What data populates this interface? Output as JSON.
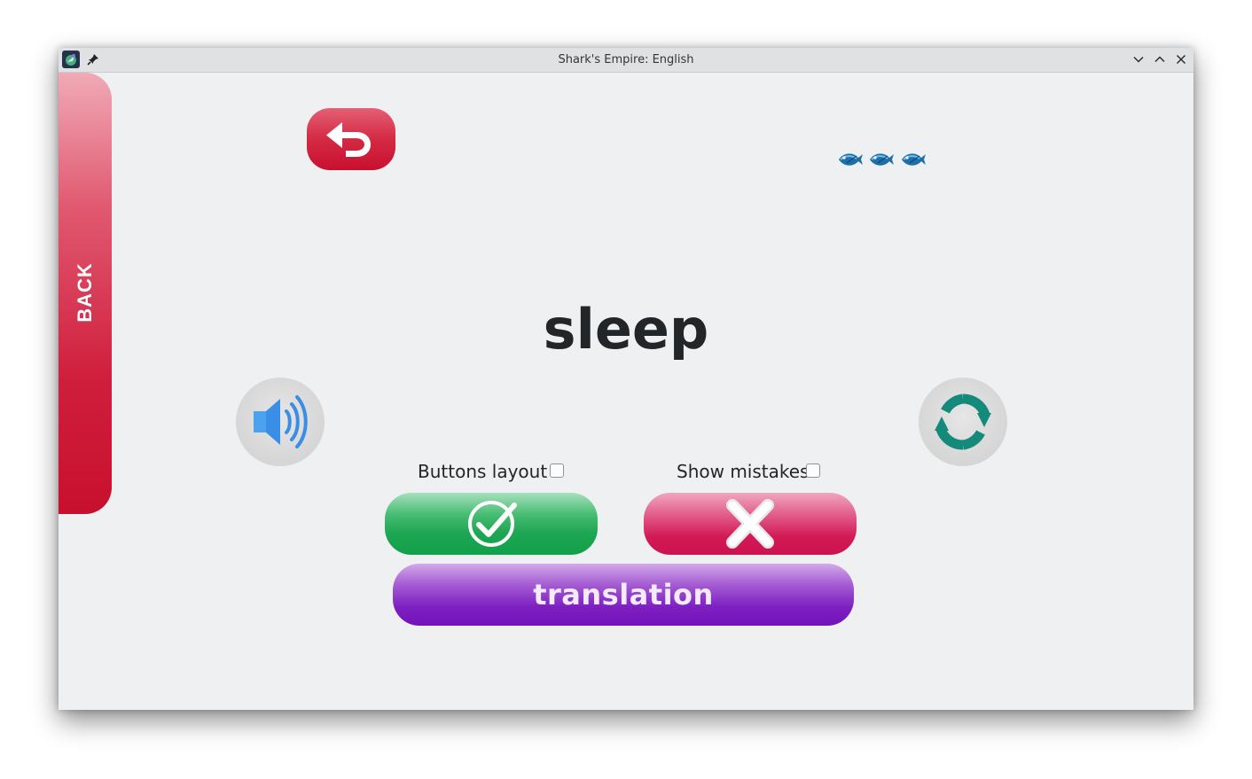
{
  "window": {
    "title": "Shark's Empire: English"
  },
  "sidebar": {
    "back_label": "BACK"
  },
  "card": {
    "word": "sleep",
    "lives_remaining": 3,
    "lives_icon": "fish-icon"
  },
  "options": {
    "buttons_layout_label": "Buttons layout",
    "buttons_layout_checked": false,
    "show_mistakes_label": "Show mistakes",
    "show_mistakes_checked": false
  },
  "actions": {
    "translation_label": "translation"
  },
  "icons": {
    "undo": "undo-icon",
    "speaker": "speaker-icon",
    "refresh": "refresh-icon",
    "correct": "check-circle-icon",
    "wrong": "x-mark-icon"
  },
  "colors": {
    "back_tab": "#c8102e",
    "undo_button": "#c8102e",
    "correct_button": "#12a04a",
    "wrong_button": "#cc1150",
    "translation_button": "#7312bb",
    "speaker": "#3a8ee6",
    "refresh": "#138a7a"
  }
}
